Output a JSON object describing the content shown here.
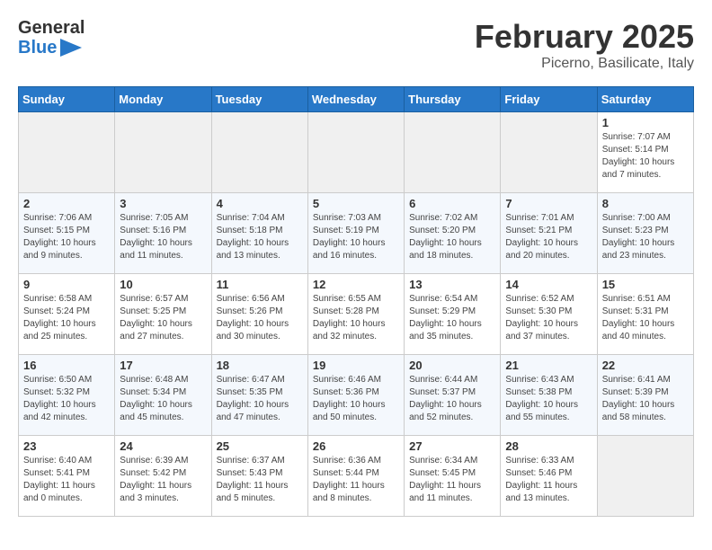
{
  "header": {
    "logo_general": "General",
    "logo_blue": "Blue",
    "title": "February 2025",
    "subtitle": "Picerno, Basilicate, Italy"
  },
  "days_of_week": [
    "Sunday",
    "Monday",
    "Tuesday",
    "Wednesday",
    "Thursday",
    "Friday",
    "Saturday"
  ],
  "weeks": [
    [
      {
        "day": "",
        "info": ""
      },
      {
        "day": "",
        "info": ""
      },
      {
        "day": "",
        "info": ""
      },
      {
        "day": "",
        "info": ""
      },
      {
        "day": "",
        "info": ""
      },
      {
        "day": "",
        "info": ""
      },
      {
        "day": "1",
        "info": "Sunrise: 7:07 AM\nSunset: 5:14 PM\nDaylight: 10 hours and 7 minutes."
      }
    ],
    [
      {
        "day": "2",
        "info": "Sunrise: 7:06 AM\nSunset: 5:15 PM\nDaylight: 10 hours and 9 minutes."
      },
      {
        "day": "3",
        "info": "Sunrise: 7:05 AM\nSunset: 5:16 PM\nDaylight: 10 hours and 11 minutes."
      },
      {
        "day": "4",
        "info": "Sunrise: 7:04 AM\nSunset: 5:18 PM\nDaylight: 10 hours and 13 minutes."
      },
      {
        "day": "5",
        "info": "Sunrise: 7:03 AM\nSunset: 5:19 PM\nDaylight: 10 hours and 16 minutes."
      },
      {
        "day": "6",
        "info": "Sunrise: 7:02 AM\nSunset: 5:20 PM\nDaylight: 10 hours and 18 minutes."
      },
      {
        "day": "7",
        "info": "Sunrise: 7:01 AM\nSunset: 5:21 PM\nDaylight: 10 hours and 20 minutes."
      },
      {
        "day": "8",
        "info": "Sunrise: 7:00 AM\nSunset: 5:23 PM\nDaylight: 10 hours and 23 minutes."
      }
    ],
    [
      {
        "day": "9",
        "info": "Sunrise: 6:58 AM\nSunset: 5:24 PM\nDaylight: 10 hours and 25 minutes."
      },
      {
        "day": "10",
        "info": "Sunrise: 6:57 AM\nSunset: 5:25 PM\nDaylight: 10 hours and 27 minutes."
      },
      {
        "day": "11",
        "info": "Sunrise: 6:56 AM\nSunset: 5:26 PM\nDaylight: 10 hours and 30 minutes."
      },
      {
        "day": "12",
        "info": "Sunrise: 6:55 AM\nSunset: 5:28 PM\nDaylight: 10 hours and 32 minutes."
      },
      {
        "day": "13",
        "info": "Sunrise: 6:54 AM\nSunset: 5:29 PM\nDaylight: 10 hours and 35 minutes."
      },
      {
        "day": "14",
        "info": "Sunrise: 6:52 AM\nSunset: 5:30 PM\nDaylight: 10 hours and 37 minutes."
      },
      {
        "day": "15",
        "info": "Sunrise: 6:51 AM\nSunset: 5:31 PM\nDaylight: 10 hours and 40 minutes."
      }
    ],
    [
      {
        "day": "16",
        "info": "Sunrise: 6:50 AM\nSunset: 5:32 PM\nDaylight: 10 hours and 42 minutes."
      },
      {
        "day": "17",
        "info": "Sunrise: 6:48 AM\nSunset: 5:34 PM\nDaylight: 10 hours and 45 minutes."
      },
      {
        "day": "18",
        "info": "Sunrise: 6:47 AM\nSunset: 5:35 PM\nDaylight: 10 hours and 47 minutes."
      },
      {
        "day": "19",
        "info": "Sunrise: 6:46 AM\nSunset: 5:36 PM\nDaylight: 10 hours and 50 minutes."
      },
      {
        "day": "20",
        "info": "Sunrise: 6:44 AM\nSunset: 5:37 PM\nDaylight: 10 hours and 52 minutes."
      },
      {
        "day": "21",
        "info": "Sunrise: 6:43 AM\nSunset: 5:38 PM\nDaylight: 10 hours and 55 minutes."
      },
      {
        "day": "22",
        "info": "Sunrise: 6:41 AM\nSunset: 5:39 PM\nDaylight: 10 hours and 58 minutes."
      }
    ],
    [
      {
        "day": "23",
        "info": "Sunrise: 6:40 AM\nSunset: 5:41 PM\nDaylight: 11 hours and 0 minutes."
      },
      {
        "day": "24",
        "info": "Sunrise: 6:39 AM\nSunset: 5:42 PM\nDaylight: 11 hours and 3 minutes."
      },
      {
        "day": "25",
        "info": "Sunrise: 6:37 AM\nSunset: 5:43 PM\nDaylight: 11 hours and 5 minutes."
      },
      {
        "day": "26",
        "info": "Sunrise: 6:36 AM\nSunset: 5:44 PM\nDaylight: 11 hours and 8 minutes."
      },
      {
        "day": "27",
        "info": "Sunrise: 6:34 AM\nSunset: 5:45 PM\nDaylight: 11 hours and 11 minutes."
      },
      {
        "day": "28",
        "info": "Sunrise: 6:33 AM\nSunset: 5:46 PM\nDaylight: 11 hours and 13 minutes."
      },
      {
        "day": "",
        "info": ""
      }
    ]
  ]
}
